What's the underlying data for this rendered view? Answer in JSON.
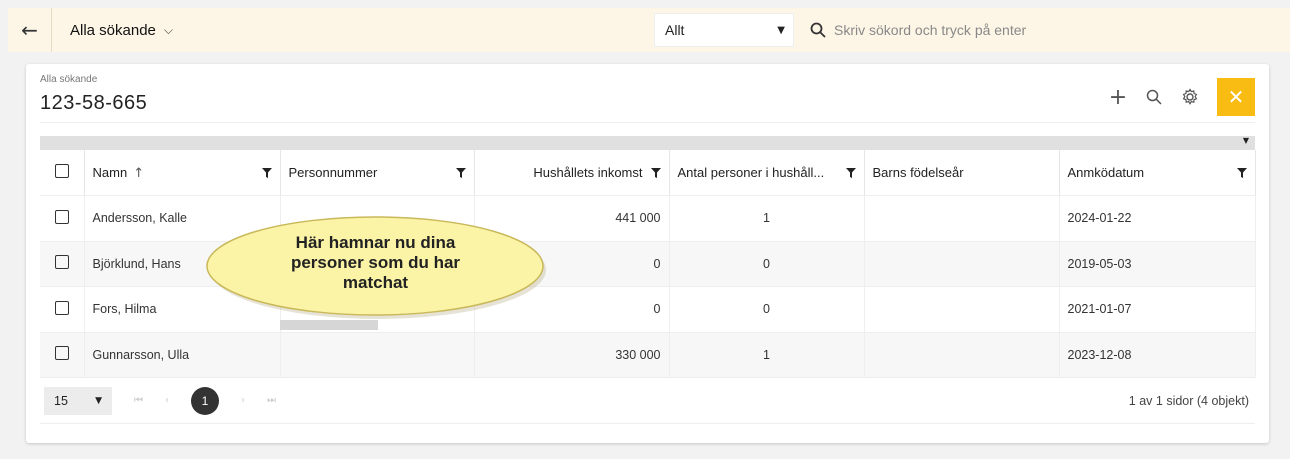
{
  "topbar": {
    "back_icon": "arrow-left-icon",
    "title": "Alla sökande",
    "filter_value": "Allt",
    "search_placeholder": "Skriv sökord och tryck på enter"
  },
  "card": {
    "breadcrumb": "Alla sökande",
    "case_id": "123-58-665",
    "actions": [
      "plus-icon",
      "search-icon",
      "gear-icon",
      "close-icon"
    ]
  },
  "table": {
    "columns": [
      {
        "label": "Namn",
        "sort": "↑"
      },
      {
        "label": "Personnummer"
      },
      {
        "label": "Hushållets inkomst"
      },
      {
        "label": "Antal personer i hushåll..."
      },
      {
        "label": "Barns födelseår"
      },
      {
        "label": "Anmködatum"
      }
    ],
    "rows": [
      {
        "namn": "Andersson, Kalle",
        "personnummer": "",
        "inkomst": "441 000",
        "antal": "1",
        "barn": "",
        "datum": "2024-01-22"
      },
      {
        "namn": "Björklund, Hans",
        "personnummer": "",
        "inkomst": "0",
        "antal": "0",
        "barn": "",
        "datum": "2019-05-03"
      },
      {
        "namn": "Fors, Hilma",
        "personnummer": "",
        "inkomst": "0",
        "antal": "0",
        "barn": "",
        "datum": "2021-01-07"
      },
      {
        "namn": "Gunnarsson, Ulla",
        "personnummer": "",
        "inkomst": "330 000",
        "antal": "1",
        "barn": "",
        "datum": "2023-12-08"
      }
    ]
  },
  "pager": {
    "page_size": "15",
    "current_page": "1",
    "info": "1 av 1 sidor (4 objekt)"
  },
  "callout": {
    "text_lines": [
      "Här hamnar nu dina",
      "personer som du har",
      "matchat"
    ],
    "fill": "#fbf4a6",
    "stroke": "#c9b85a"
  },
  "colors": {
    "accent": "#f9bc13",
    "topbar_bg": "#fdf6e6"
  }
}
